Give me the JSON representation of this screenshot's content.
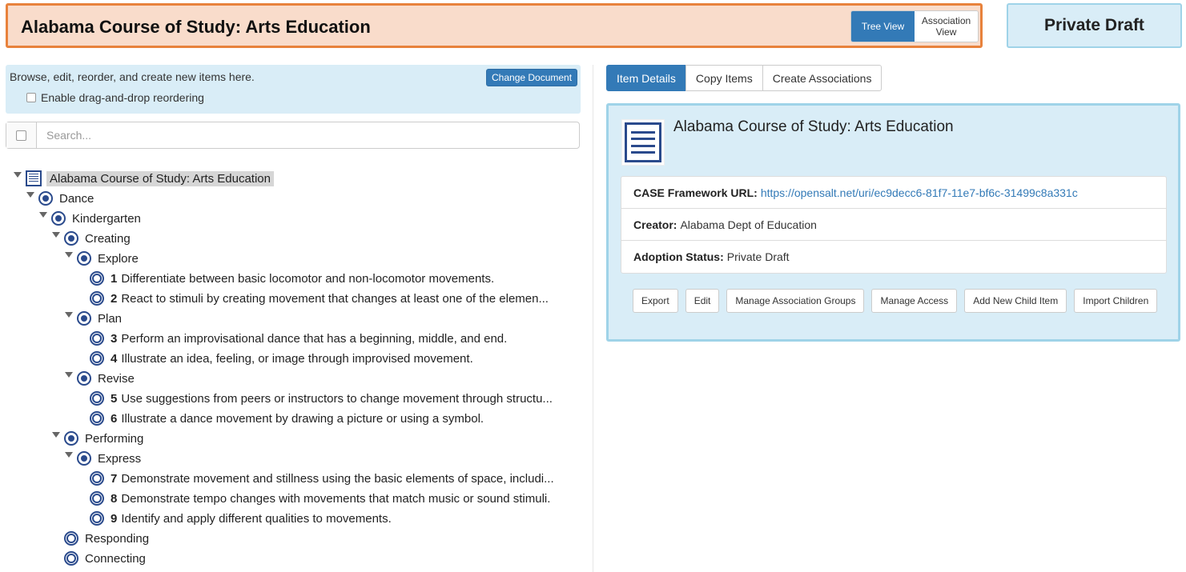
{
  "header": {
    "title": "Alabama Course of Study: Arts Education",
    "view_toggle": {
      "tree_view": "Tree View",
      "association_view": "Association View"
    },
    "status": "Private Draft"
  },
  "left_panel": {
    "info_message": "Browse, edit, reorder, and create new items here.",
    "change_document_label": "Change Document",
    "drag_drop_label": "Enable drag-and-drop reordering",
    "search_placeholder": "Search..."
  },
  "tree": [
    {
      "label": "Alabama Course of Study: Arts Education"
    },
    {
      "label": "Dance"
    },
    {
      "label": "Kindergarten"
    },
    {
      "label": "Creating"
    },
    {
      "label": "Explore"
    },
    {
      "num": "1",
      "label": "Differentiate between basic locomotor and non-locomotor movements."
    },
    {
      "num": "2",
      "label": "React to stimuli by creating movement that changes at least one of the elemen..."
    },
    {
      "label": "Plan"
    },
    {
      "num": "3",
      "label": "Perform an improvisational dance that has a beginning, middle, and end."
    },
    {
      "num": "4",
      "label": "Illustrate an idea, feeling, or image through improvised movement."
    },
    {
      "label": "Revise"
    },
    {
      "num": "5",
      "label": "Use suggestions from peers or instructors to change movement through structu..."
    },
    {
      "num": "6",
      "label": "Illustrate a dance movement by drawing a picture or using a symbol."
    },
    {
      "label": "Performing"
    },
    {
      "label": "Express"
    },
    {
      "num": "7",
      "label": "Demonstrate movement and stillness using the basic elements of space, includi..."
    },
    {
      "num": "8",
      "label": "Demonstrate tempo changes with movements that match music or sound stimuli."
    },
    {
      "num": "9",
      "label": "Identify and apply different qualities to movements."
    },
    {
      "label": "Responding"
    },
    {
      "label": "Connecting"
    }
  ],
  "right_panel": {
    "tabs": [
      "Item Details",
      "Copy Items",
      "Create Associations"
    ],
    "details": {
      "title": "Alabama Course of Study: Arts Education",
      "framework_url_label": "CASE Framework URL:",
      "framework_url": "https://opensalt.net/uri/ec9decc6-81f7-11e7-bf6c-31499c8a331c",
      "creator_label": "Creator:",
      "creator": "Alabama Dept of Education",
      "adoption_label": "Adoption Status:",
      "adoption": "Private Draft"
    },
    "actions": [
      "Export",
      "Edit",
      "Manage Association Groups",
      "Manage Access",
      "Add New Child Item",
      "Import Children"
    ]
  },
  "colors": {
    "primary": "#337ab7",
    "title_bg": "#f9dccb",
    "title_border": "#e8823c",
    "info_bg": "#d9edf7",
    "icon_navy": "#2a4a8c"
  }
}
